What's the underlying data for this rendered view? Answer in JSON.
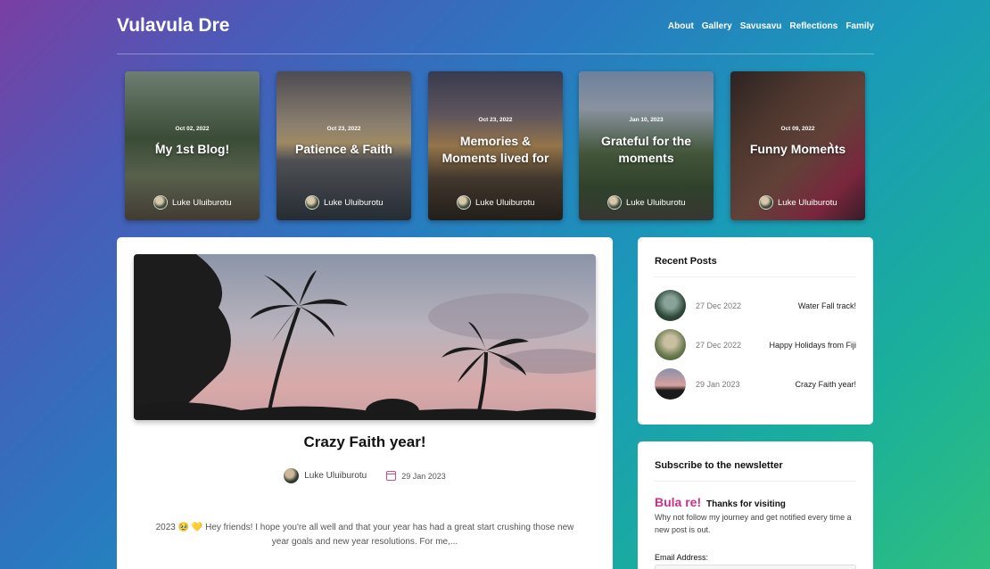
{
  "header": {
    "brand": "Vulavula Dre",
    "nav": [
      "About",
      "Gallery",
      "Savusavu",
      "Reflections",
      "Family"
    ]
  },
  "carousel": {
    "cards": [
      {
        "date": "Oct 02, 2022",
        "title": "My 1st Blog!",
        "author": "Luke Uluiburotu"
      },
      {
        "date": "Oct 23, 2022",
        "title": "Patience & Faith",
        "author": "Luke Uluiburotu"
      },
      {
        "date": "Oct 23, 2022",
        "title": "Memories & Moments lived for",
        "author": "Luke Uluiburotu"
      },
      {
        "date": "Jan 10, 2023",
        "title": "Grateful for the moments",
        "author": "Luke Uluiburotu"
      },
      {
        "date": "Oct 09, 2022",
        "title": "Funny Moments",
        "author": "Luke Uluiburotu"
      }
    ],
    "prev_icon": "‹",
    "next_icon": "›"
  },
  "post": {
    "title": "Crazy Faith year!",
    "author": "Luke Uluiburotu",
    "date": "29 Jan 2023",
    "excerpt": "2023 🥹 💛 Hey friends! I hope you're all well and that your year has had a great start crushing those new year goals and new year resolutions. For me,..."
  },
  "recent_posts": {
    "title": "Recent Posts",
    "items": [
      {
        "date": "27 Dec 2022",
        "title": "Water Fall track!"
      },
      {
        "date": "27 Dec 2022",
        "title": "Happy Holidays from Fiji"
      },
      {
        "date": "29 Jan 2023",
        "title": "Crazy Faith year!"
      }
    ]
  },
  "newsletter": {
    "title": "Subscribe to the newsletter",
    "greeting": "Bula re!",
    "greeting_sub": "Thanks for visiting",
    "text": "Why not follow my journey and get notified every time a new post is out.",
    "email_label": "Email Address:"
  }
}
